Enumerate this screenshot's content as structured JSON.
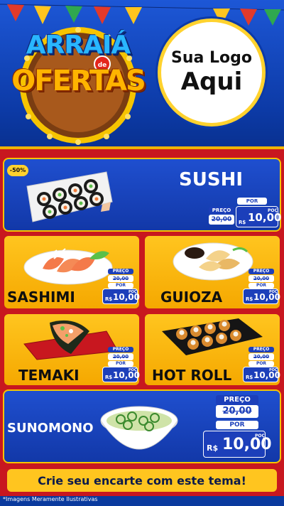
{
  "header": {
    "event_title_line1": "ARRAIÁ",
    "event_title_connector": "de",
    "event_title_line2": "OFERTAS",
    "brand_placeholder_line1": "Sua Logo",
    "brand_placeholder_line2": "Aqui"
  },
  "products": [
    {
      "name": "SUSHI",
      "discount_badge": "-50%",
      "price_label": "PREÇO",
      "old_price": "20,00",
      "por_label": "POR",
      "currency": "R$",
      "new_price": "10,00",
      "unit": "POÇ"
    },
    {
      "name": "SASHIMI",
      "price_label": "PREÇO",
      "old_price": "20,00",
      "por_label": "POR",
      "currency": "R$",
      "new_price": "10,00",
      "unit": "POÇ"
    },
    {
      "name": "GUIOZA",
      "price_label": "PREÇO",
      "old_price": "20,00",
      "por_label": "POR",
      "currency": "R$",
      "new_price": "10,00",
      "unit": "POÇ"
    },
    {
      "name": "TEMAKI",
      "price_label": "PREÇO",
      "old_price": "20,00",
      "por_label": "POR",
      "currency": "R$",
      "new_price": "10,00",
      "unit": "POÇ"
    },
    {
      "name": "HOT ROLL",
      "price_label": "PREÇO",
      "old_price": "20,00",
      "por_label": "POR",
      "currency": "R$",
      "new_price": "10,00",
      "unit": "POÇ"
    },
    {
      "name": "SUNOMONO",
      "price_label": "PREÇO",
      "old_price": "20,00",
      "por_label": "POR",
      "currency": "R$",
      "new_price": "10,00",
      "unit": "POÇ"
    }
  ],
  "cta_text": "Crie seu encarte com este tema!",
  "footnote": "*Imagens Meramente Ilustrativas",
  "colors": {
    "header_blue": "#1d57d6",
    "board_red": "#c8171f",
    "card_yellow": "#ffc51f",
    "card_blue": "#1238a8",
    "tag_blue": "#1c3fba"
  }
}
